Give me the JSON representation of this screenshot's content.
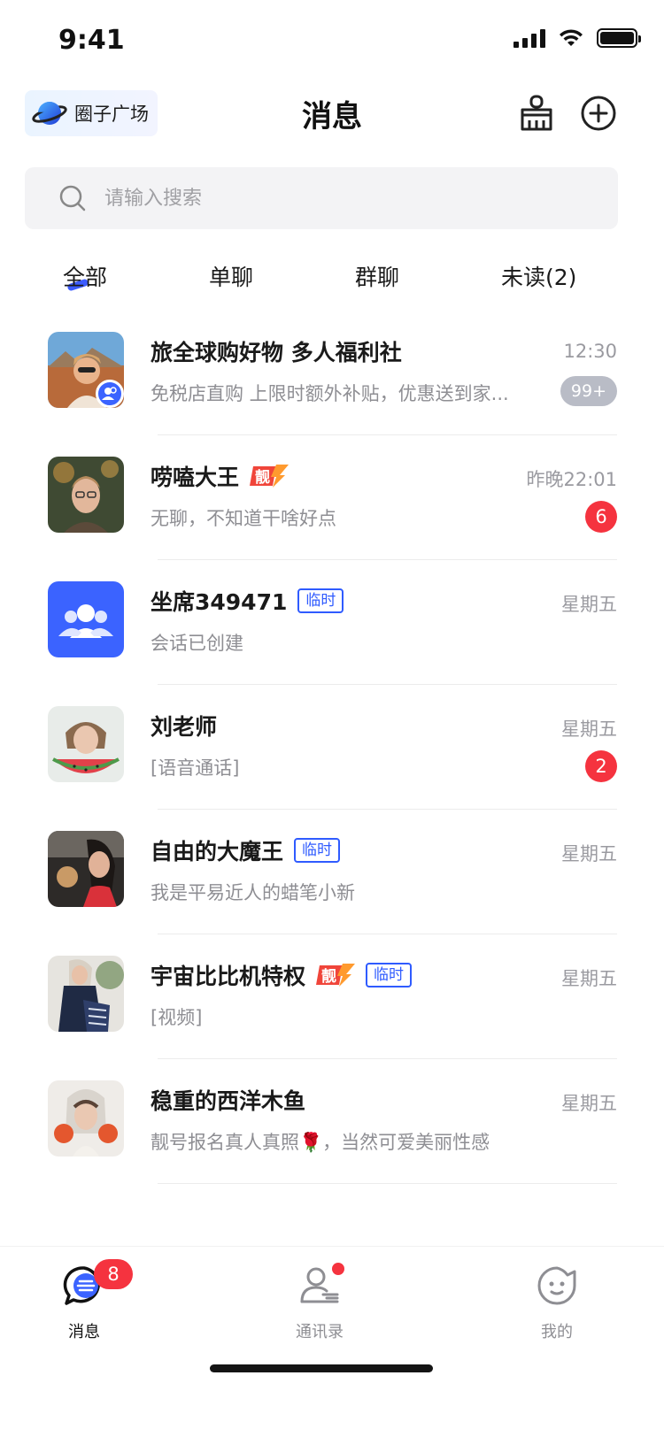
{
  "status_bar": {
    "time": "9:41"
  },
  "nav": {
    "circle_label": "圈子广场",
    "title": "消息"
  },
  "search": {
    "placeholder": "请输入搜索"
  },
  "tabs": [
    {
      "label": "全部",
      "active": true
    },
    {
      "label": "单聊",
      "active": false
    },
    {
      "label": "群聊",
      "active": false
    },
    {
      "label": "未读(2)",
      "active": false
    }
  ],
  "conversations": [
    {
      "name": "旅全球购好物 多人福利社",
      "preview": "免税店直购 上限时额外补贴，优惠送到家...",
      "time": "12:30",
      "badge": "99+",
      "badge_style": "gray",
      "avatar": "photo-woman-sunglasses",
      "group": true
    },
    {
      "name": "唠嗑大王",
      "preview": "无聊，不知道干啥好点",
      "time": "昨晚22:01",
      "badge": "6",
      "badge_style": "red",
      "avatar": "photo-man-glasses",
      "tag_liang": "靓"
    },
    {
      "name": "坐席349471",
      "preview": "会话已创建",
      "time": "星期五",
      "tag_temp": "临时",
      "avatar": "group-icon"
    },
    {
      "name": "刘老师",
      "preview": "[语音通话]",
      "time": "星期五",
      "badge": "2",
      "badge_style": "red",
      "avatar": "photo-woman-watermelon"
    },
    {
      "name": "自由的大魔王",
      "preview": "我是平易近人的蜡笔小新",
      "time": "星期五",
      "tag_temp": "临时",
      "avatar": "photo-woman-car"
    },
    {
      "name": "宇宙比比机特权",
      "preview": "[视频]",
      "time": "星期五",
      "tag_liang": "靓",
      "tag_temp": "临时",
      "avatar": "photo-woman-scarf"
    },
    {
      "name": "稳重的西洋木鱼",
      "preview": "靓号报名真人真照🌹，当然可爱美丽性感",
      "time": "星期五",
      "avatar": "photo-woman-oranges"
    }
  ],
  "tabbar": {
    "messages_label": "消息",
    "messages_badge": "8",
    "contacts_label": "通讯录",
    "me_label": "我的"
  },
  "colors": {
    "accent": "#3b5bff",
    "badge_red": "#f5333f",
    "badge_gray": "#b9bcc6"
  }
}
